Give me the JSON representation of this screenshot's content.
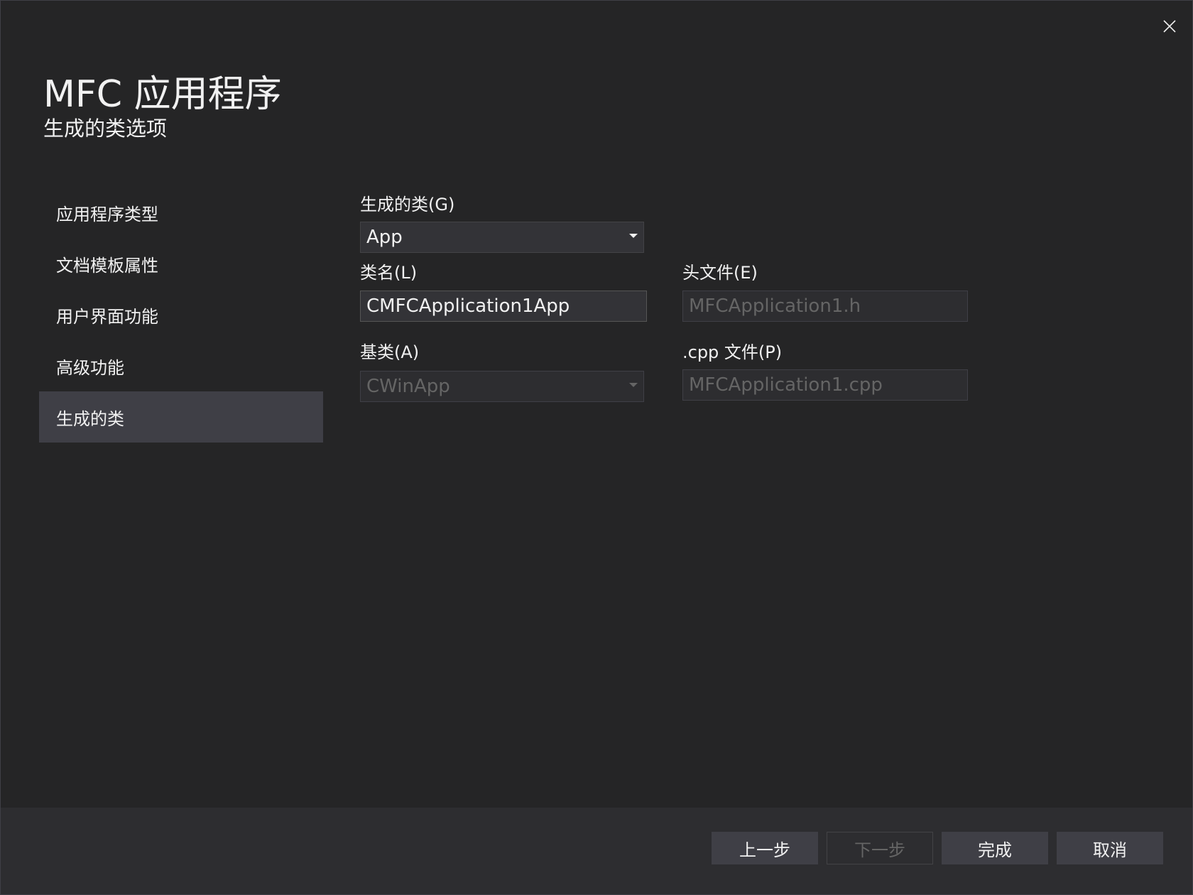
{
  "header": {
    "title": "MFC 应用程序",
    "subtitle": "生成的类选项"
  },
  "nav": {
    "items": [
      {
        "label": "应用程序类型"
      },
      {
        "label": "文档模板属性"
      },
      {
        "label": "用户界面功能"
      },
      {
        "label": "高级功能"
      },
      {
        "label": "生成的类",
        "active": true
      }
    ]
  },
  "form": {
    "generated_class_label": "生成的类(G)",
    "generated_class_value": "App",
    "class_name_label": "类名(L)",
    "class_name_value": "CMFCApplication1App",
    "header_file_label": "头文件(E)",
    "header_file_value": "MFCApplication1.h",
    "base_class_label": "基类(A)",
    "base_class_value": "CWinApp",
    "cpp_file_label": ".cpp 文件(P)",
    "cpp_file_value": "MFCApplication1.cpp"
  },
  "footer": {
    "back_label": "上一步",
    "next_label": "下一步",
    "finish_label": "完成",
    "cancel_label": "取消"
  },
  "icons": {
    "close": "close-icon",
    "dropdown": "chevron-down-icon"
  },
  "colors": {
    "background": "#252526",
    "nav_active": "#3f3f46",
    "text": "#f1f1f1",
    "disabled_text": "#656565"
  }
}
